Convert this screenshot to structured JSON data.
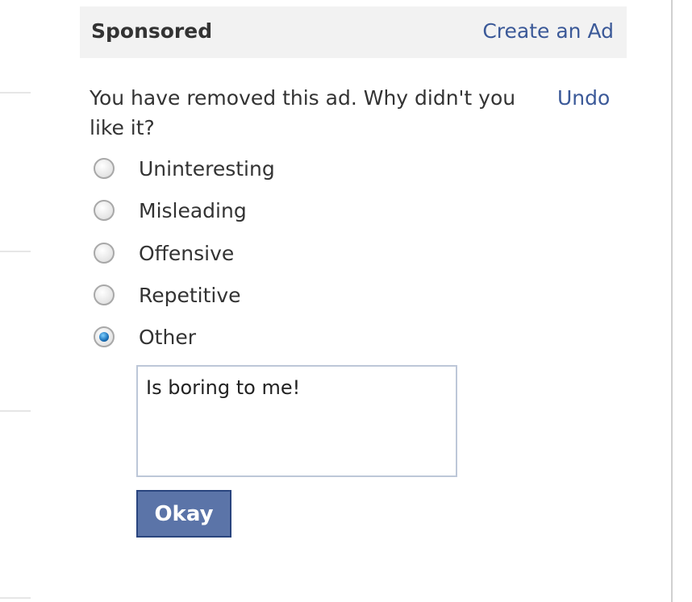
{
  "header": {
    "title": "Sponsored",
    "create_ad_link": "Create an Ad"
  },
  "feedback": {
    "message": "You have removed this ad. Why didn't you like it?",
    "undo_link": "Undo",
    "options": [
      {
        "label": "Uninteresting",
        "checked": false
      },
      {
        "label": "Misleading",
        "checked": false
      },
      {
        "label": "Offensive",
        "checked": false
      },
      {
        "label": "Repetitive",
        "checked": false
      },
      {
        "label": "Other",
        "checked": true
      }
    ],
    "other_text": "Is boring to me!",
    "okay_button": "Okay"
  },
  "colors": {
    "link": "#3b5998",
    "button": "#5b74a8",
    "header_bg": "#f2f2f2"
  }
}
